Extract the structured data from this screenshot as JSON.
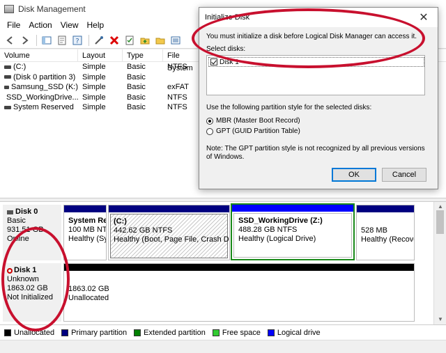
{
  "window": {
    "title": "Disk Management"
  },
  "menu": [
    "File",
    "Action",
    "View",
    "Help"
  ],
  "volume_table": {
    "headers": [
      "Volume",
      "Layout",
      "Type",
      "File System"
    ],
    "rows": [
      [
        "(C:)",
        "Simple",
        "Basic",
        "NTFS"
      ],
      [
        "(Disk 0 partition 3)",
        "Simple",
        "Basic",
        ""
      ],
      [
        "Samsung_SSD (K:)",
        "Simple",
        "Basic",
        "exFAT"
      ],
      [
        "SSD_WorkingDrive...",
        "Simple",
        "Basic",
        "NTFS"
      ],
      [
        "System Reserved",
        "Simple",
        "Basic",
        "NTFS"
      ]
    ]
  },
  "disks": {
    "disk0": {
      "name": "Disk 0",
      "type": "Basic",
      "size": "931.51 GB",
      "status": "Online",
      "partitions": [
        {
          "name": "System Re",
          "size": "100 MB NT",
          "status": "Healthy (Sy"
        },
        {
          "name": "(C:)",
          "size": "442.62 GB NTFS",
          "status": "Healthy (Boot, Page File, Crash Dump"
        },
        {
          "name": "SSD_WorkingDrive (Z:)",
          "size": "488.28 GB NTFS",
          "status": "Healthy (Logical Drive)"
        },
        {
          "name": "",
          "size": "528 MB",
          "status": "Healthy (Recove"
        }
      ]
    },
    "disk1": {
      "name": "Disk 1",
      "type": "Unknown",
      "size": "1863.02 GB",
      "status": "Not Initialized",
      "partitions": [
        {
          "size": "1863.02 GB",
          "status": "Unallocated"
        }
      ]
    }
  },
  "legend": [
    {
      "label": "Unallocated",
      "color": "#000000"
    },
    {
      "label": "Primary partition",
      "color": "#000080"
    },
    {
      "label": "Extended partition",
      "color": "#008000"
    },
    {
      "label": "Free space",
      "color": "#33cc33"
    },
    {
      "label": "Logical drive",
      "color": "#0000ff"
    }
  ],
  "dialog": {
    "title": "Initialize Disk",
    "message": "You must initialize a disk before Logical Disk Manager can access it.",
    "select_label": "Select disks:",
    "disk_item": "Disk 1",
    "style_label": "Use the following partition style for the selected disks:",
    "option_mbr": "MBR (Master Boot Record)",
    "option_gpt": "GPT (GUID Partition Table)",
    "note": "Note: The GPT partition style is not recognized by all previous versions of Windows.",
    "ok": "OK",
    "cancel": "Cancel"
  },
  "colors": {
    "primary_bar": "#000080",
    "logical_bar": "#0000ff",
    "unallocated_bar": "#000000",
    "logical_border": "#1a8a1a",
    "annotation": "#c8102e"
  }
}
